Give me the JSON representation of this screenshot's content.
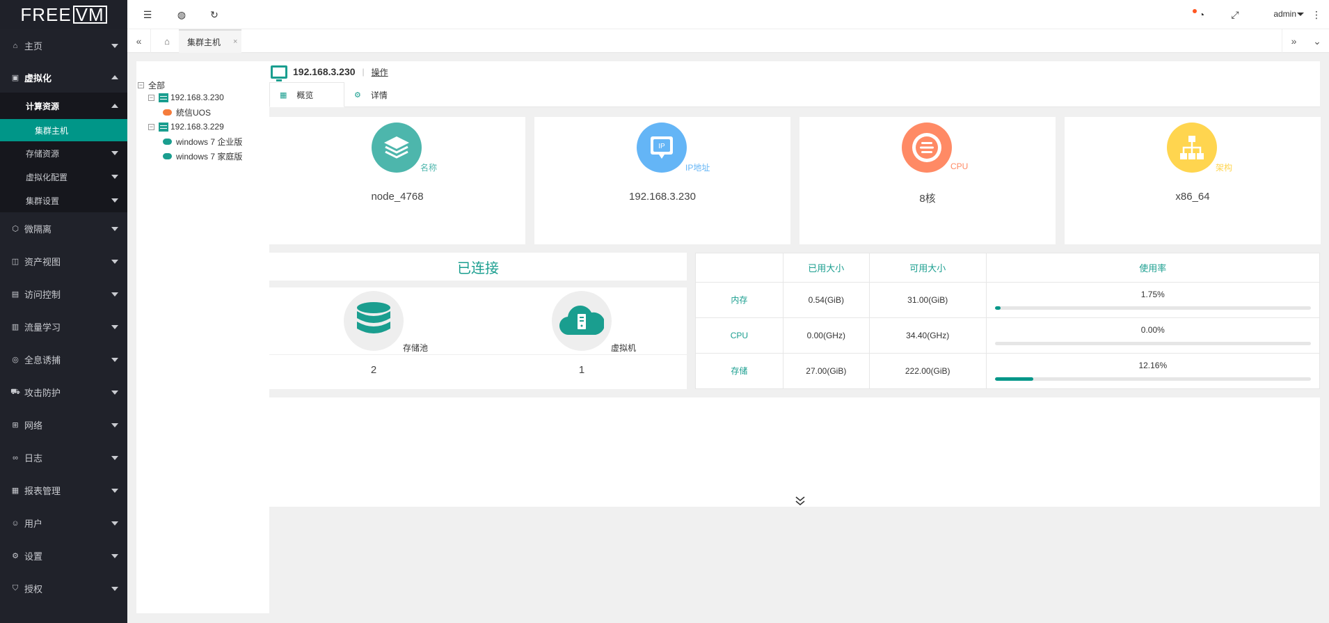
{
  "logo": {
    "left": "FREE",
    "right": "VM"
  },
  "sidebar": {
    "items": [
      {
        "label": "主页"
      },
      {
        "label": "虚拟化"
      },
      {
        "label": "微隔离"
      },
      {
        "label": "资产视图"
      },
      {
        "label": "访问控制"
      },
      {
        "label": "流量学习"
      },
      {
        "label": "全息诱捕"
      },
      {
        "label": "攻击防护"
      },
      {
        "label": "网络"
      },
      {
        "label": "日志"
      },
      {
        "label": "报表管理"
      },
      {
        "label": "用户"
      },
      {
        "label": "设置"
      },
      {
        "label": "授权"
      }
    ],
    "sub": {
      "compute": "计算资源",
      "cluster_host": "集群主机",
      "storage": "存储资源",
      "virt_config": "虚拟化配置",
      "cluster_settings": "集群设置"
    }
  },
  "topbar": {
    "user": "admin"
  },
  "tabs": {
    "active": "集群主机",
    "close": "×"
  },
  "tree": {
    "root": "全部",
    "hosts": [
      {
        "ip": "192.168.3.230",
        "vms": [
          "統信UOS"
        ]
      },
      {
        "ip": "192.168.3.229",
        "vms": [
          "windows 7 企业版",
          "windows 7 家庭版"
        ]
      }
    ]
  },
  "host": {
    "ip": "192.168.3.230",
    "separator": "|",
    "operation": "操作"
  },
  "subtabs": {
    "overview": "概览",
    "detail": "详情"
  },
  "cards": [
    {
      "label": "名称",
      "value": "node_4768",
      "color": "#4db6ac",
      "icon": "layers-icon"
    },
    {
      "label": "IP地址",
      "value": "192.168.3.230",
      "color": "#64b5f6",
      "icon": "ip-icon",
      "icon_text": "IP"
    },
    {
      "label": "CPU",
      "value": "8核",
      "color": "#ff8a65",
      "icon": "cpu-icon"
    },
    {
      "label": "架构",
      "value": "x86_64",
      "color": "#ffd54f",
      "icon": "sitemap-icon"
    }
  ],
  "connection": {
    "title": "已连接",
    "items": [
      {
        "label": "存储池",
        "value": "2"
      },
      {
        "label": "虚拟机",
        "value": "1"
      }
    ]
  },
  "usage": {
    "headers": [
      "",
      "已用大小",
      "可用大小",
      "使用率"
    ],
    "rows": [
      {
        "name": "内存",
        "used": "0.54(GiB)",
        "free": "31.00(GiB)",
        "rate": "1.75%",
        "ratio": 0.0175
      },
      {
        "name": "CPU",
        "used": "0.00(GHz)",
        "free": "34.40(GHz)",
        "rate": "0.00%",
        "ratio": 0.0
      },
      {
        "name": "存储",
        "used": "27.00(GiB)",
        "free": "222.00(GiB)",
        "rate": "12.16%",
        "ratio": 0.1216
      }
    ]
  },
  "colors": {
    "primary": "#009688",
    "sidebar_bg": "#20222a"
  }
}
